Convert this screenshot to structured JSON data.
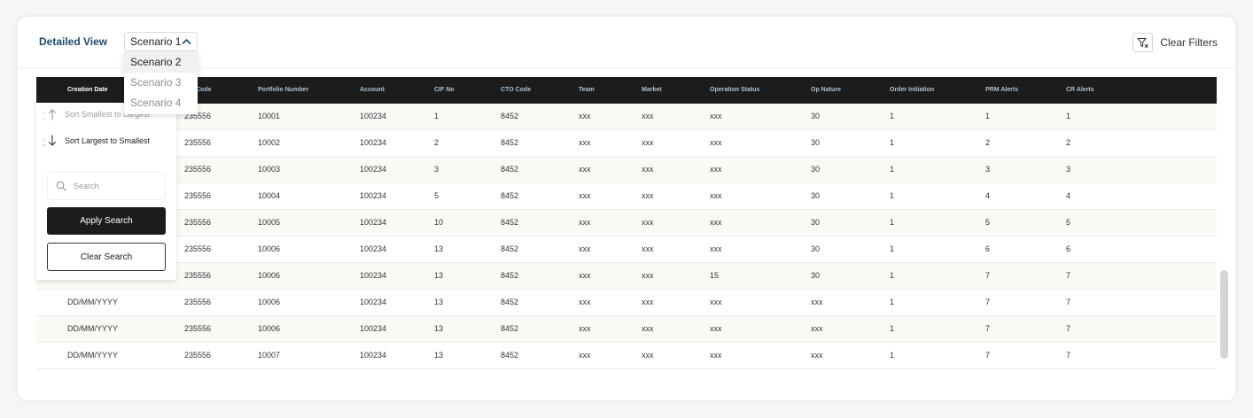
{
  "header": {
    "title": "Detailed View",
    "scenario_selected": "Scenario 1",
    "scenario_options": [
      "Scenario 2",
      "Scenario 3",
      "Scenario 4"
    ],
    "clear_filters": "Clear Filters"
  },
  "columns": [
    "Creation Date",
    "Code",
    "Portfolio Number",
    "Account",
    "CIF No",
    "CTO Code",
    "Team",
    "Market",
    "Operation Status",
    "Op Nature",
    "Order Initiation",
    "PRM Alerts",
    "CR Alerts"
  ],
  "rows": [
    [
      "",
      "235556",
      "10001",
      "100234",
      "1",
      "8452",
      "xxx",
      "xxx",
      "xxx",
      "30",
      "1",
      "1",
      "1"
    ],
    [
      "",
      "235556",
      "10002",
      "100234",
      "2",
      "8452",
      "xxx",
      "xxx",
      "xxx",
      "30",
      "1",
      "2",
      "2"
    ],
    [
      "",
      "235556",
      "10003",
      "100234",
      "3",
      "8452",
      "xxx",
      "xxx",
      "xxx",
      "30",
      "1",
      "3",
      "3"
    ],
    [
      "",
      "235556",
      "10004",
      "100234",
      "5",
      "8452",
      "xxx",
      "xxx",
      "xxx",
      "30",
      "1",
      "4",
      "4"
    ],
    [
      "",
      "235556",
      "10005",
      "100234",
      "10",
      "8452",
      "xxx",
      "xxx",
      "xxx",
      "30",
      "1",
      "5",
      "5"
    ],
    [
      "",
      "235556",
      "10006",
      "100234",
      "13",
      " 8452",
      "xxx",
      "xxx",
      "xxx",
      "30",
      "1",
      "6",
      "6"
    ],
    [
      "",
      "235556",
      "10006",
      "100234",
      "13",
      "8452",
      "xxx",
      "xxx",
      "15",
      "30",
      "1",
      "7",
      "7"
    ],
    [
      "DD/MM/YYYY",
      "235556",
      "10006",
      "100234",
      "13",
      "8452",
      "xxx",
      "xxx",
      "xxx",
      "xxx",
      "1",
      "7",
      "7"
    ],
    [
      "DD/MM/YYYY",
      "235556",
      "10006",
      "100234",
      "13",
      "8452",
      "xxx",
      "xxx",
      "xxx",
      "xxx",
      "1",
      "7",
      "7"
    ],
    [
      "DD/MM/YYYY",
      "235556",
      "10007",
      "100234",
      "13",
      "8452",
      "xxx",
      "xxx",
      "xxx",
      "xxx",
      "1",
      "7",
      "7"
    ]
  ],
  "sort_menu": {
    "sort_asc": "Sort Smallest to Largest",
    "sort_desc": "Sort Largest to Smallest",
    "search_placeholder": "Search",
    "apply_label": "Apply Search",
    "clear_label": "Clear Search"
  },
  "icons": {
    "chevron": "chevron-up-icon",
    "filter": "filter-clear-icon",
    "search": "search-icon",
    "sort_asc": "sort-ascending-icon",
    "sort_desc": "sort-descending-icon"
  },
  "colors": {
    "title": "#1e4a6e",
    "header_bg": "#1c1c1c",
    "header_text": "#a9c2d4",
    "row_alt": "#fbf9f6"
  }
}
